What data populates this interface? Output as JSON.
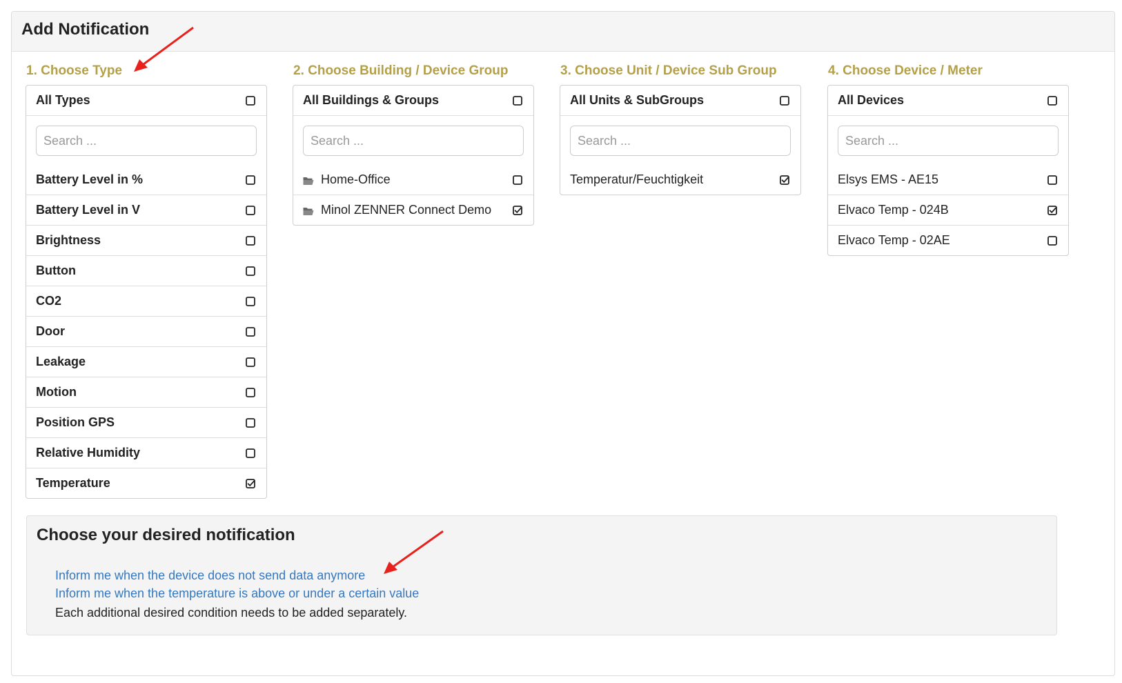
{
  "panel": {
    "title": "Add Notification"
  },
  "columns": [
    {
      "heading": "1. Choose Type",
      "all_label": "All Types",
      "all_checked": false,
      "search_placeholder": "Search ...",
      "items": [
        {
          "label": "Battery Level in %",
          "checked": false
        },
        {
          "label": "Battery Level in V",
          "checked": false
        },
        {
          "label": "Brightness",
          "checked": false
        },
        {
          "label": "Button",
          "checked": false
        },
        {
          "label": "CO2",
          "checked": false
        },
        {
          "label": "Door",
          "checked": false
        },
        {
          "label": "Leakage",
          "checked": false
        },
        {
          "label": "Motion",
          "checked": false
        },
        {
          "label": "Position GPS",
          "checked": false
        },
        {
          "label": "Relative Humidity",
          "checked": false
        },
        {
          "label": "Temperature",
          "checked": true
        }
      ]
    },
    {
      "heading": "2. Choose Building / Device Group",
      "all_label": "All Buildings & Groups",
      "all_checked": false,
      "search_placeholder": "Search ...",
      "items": [
        {
          "label": "Home-Office",
          "checked": false,
          "icon": "folder-icon"
        },
        {
          "label": "Minol ZENNER Connect Demo",
          "checked": true,
          "icon": "folder-icon"
        }
      ]
    },
    {
      "heading": "3. Choose Unit / Device Sub Group",
      "all_label": "All Units & SubGroups",
      "all_checked": false,
      "search_placeholder": "Search ...",
      "items": [
        {
          "label": "Temperatur/Feuchtigkeit",
          "checked": true
        }
      ]
    },
    {
      "heading": "4. Choose Device / Meter",
      "all_label": "All Devices",
      "all_checked": false,
      "search_placeholder": "Search ...",
      "items": [
        {
          "label": "Elsys EMS - AE15",
          "checked": false
        },
        {
          "label": "Elvaco Temp - 024B",
          "checked": true
        },
        {
          "label": "Elvaco Temp - 02AE",
          "checked": false
        }
      ]
    }
  ],
  "notification": {
    "title": "Choose your desired notification",
    "options": [
      "Inform me when the device does not send data anymore",
      "Inform me when the temperature is above or under a certain value"
    ],
    "note": "Each additional desired condition needs to be added separately."
  },
  "colors": {
    "heading_accent": "#b5a04a",
    "link": "#3478c0",
    "annotation_arrow": "#e8211c"
  }
}
